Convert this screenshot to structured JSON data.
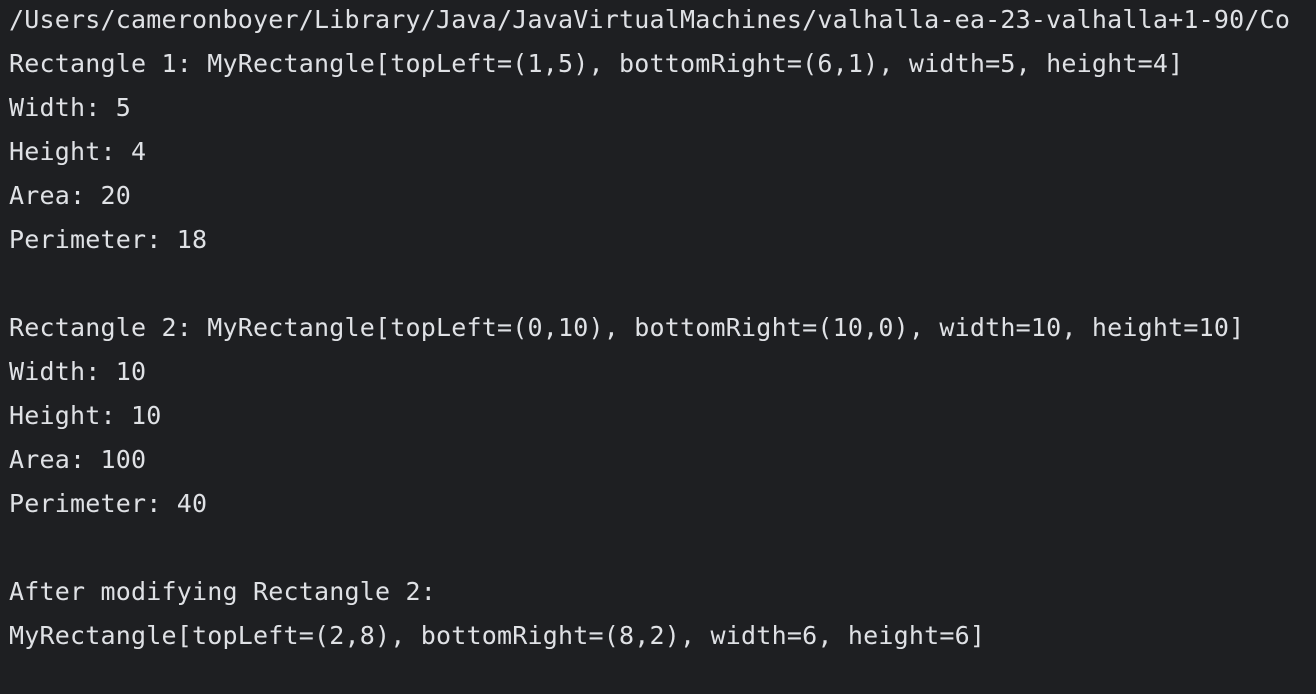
{
  "console": {
    "lines": [
      "/Users/cameronboyer/Library/Java/JavaVirtualMachines/valhalla-ea-23-valhalla+1-90/Co",
      "Rectangle 1: MyRectangle[topLeft=(1,5), bottomRight=(6,1), width=5, height=4]",
      "Width: 5",
      "Height: 4",
      "Area: 20",
      "Perimeter: 18",
      "",
      "Rectangle 2: MyRectangle[topLeft=(0,10), bottomRight=(10,0), width=10, height=10]",
      "Width: 10",
      "Height: 10",
      "Area: 100",
      "Perimeter: 40",
      "",
      "After modifying Rectangle 2:",
      "MyRectangle[topLeft=(2,8), bottomRight=(8,2), width=6, height=6]"
    ]
  },
  "colors": {
    "background": "#1e1f22",
    "text": "#dfe1e5"
  }
}
